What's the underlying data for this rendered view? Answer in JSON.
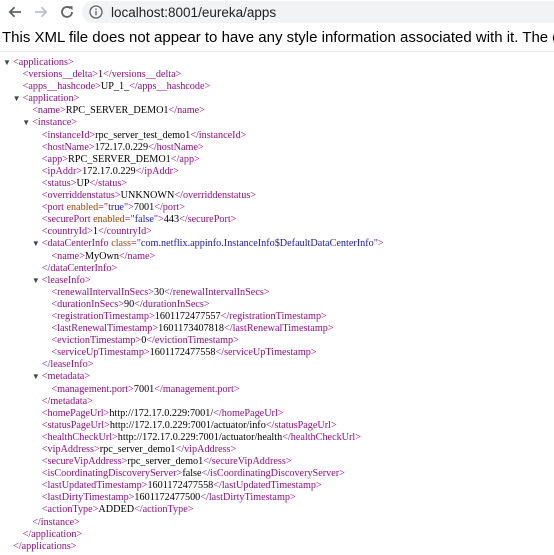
{
  "browser": {
    "url": "localhost:8001/eureka/apps",
    "back_icon": "back-arrow-icon",
    "forward_icon": "forward-arrow-icon",
    "reload_icon": "reload-icon",
    "info_icon": "info-circle-icon"
  },
  "page": {
    "notice": "This XML file does not appear to have any style information associated with it. The document tree is shown below."
  },
  "colors": {
    "tag": "#881280",
    "attr_name": "#994500",
    "attr_value": "#1a1aa6",
    "text": "#000000"
  },
  "xml_lines": [
    {
      "d": 0,
      "tog": "▼",
      "parts": [
        [
          "t",
          "<applications>"
        ]
      ]
    },
    {
      "d": 1,
      "parts": [
        [
          "t",
          "<versions__delta>"
        ],
        [
          "x",
          "1"
        ],
        [
          "t",
          "</versions__delta>"
        ]
      ]
    },
    {
      "d": 1,
      "parts": [
        [
          "t",
          "<apps__hashcode>"
        ],
        [
          "x",
          "UP_1_"
        ],
        [
          "t",
          "</apps__hashcode>"
        ]
      ]
    },
    {
      "d": 1,
      "tog": "▼",
      "parts": [
        [
          "t",
          "<application>"
        ]
      ]
    },
    {
      "d": 2,
      "parts": [
        [
          "t",
          "<name>"
        ],
        [
          "x",
          "RPC_SERVER_DEMO1"
        ],
        [
          "t",
          "</name>"
        ]
      ]
    },
    {
      "d": 2,
      "tog": "▼",
      "parts": [
        [
          "t",
          "<instance>"
        ]
      ]
    },
    {
      "d": 3,
      "parts": [
        [
          "t",
          "<instanceId>"
        ],
        [
          "x",
          "rpc_server_test_demo1"
        ],
        [
          "t",
          "</instanceId>"
        ]
      ]
    },
    {
      "d": 3,
      "parts": [
        [
          "t",
          "<hostName>"
        ],
        [
          "x",
          "172.17.0.229"
        ],
        [
          "t",
          "</hostName>"
        ]
      ]
    },
    {
      "d": 3,
      "parts": [
        [
          "t",
          "<app>"
        ],
        [
          "x",
          "RPC_SERVER_DEMO1"
        ],
        [
          "t",
          "</app>"
        ]
      ]
    },
    {
      "d": 3,
      "parts": [
        [
          "t",
          "<ipAddr>"
        ],
        [
          "x",
          "172.17.0.229"
        ],
        [
          "t",
          "</ipAddr>"
        ]
      ]
    },
    {
      "d": 3,
      "parts": [
        [
          "t",
          "<status>"
        ],
        [
          "x",
          "UP"
        ],
        [
          "t",
          "</status>"
        ]
      ]
    },
    {
      "d": 3,
      "parts": [
        [
          "t",
          "<overriddenstatus>"
        ],
        [
          "x",
          "UNKNOWN"
        ],
        [
          "t",
          "</overriddenstatus>"
        ]
      ]
    },
    {
      "d": 3,
      "parts": [
        [
          "t",
          "<port "
        ],
        [
          "a",
          "enabled"
        ],
        [
          "t",
          "=\""
        ],
        [
          "v",
          "true"
        ],
        [
          "t",
          "\">"
        ],
        [
          "x",
          "7001"
        ],
        [
          "t",
          "</port>"
        ]
      ]
    },
    {
      "d": 3,
      "parts": [
        [
          "t",
          "<securePort "
        ],
        [
          "a",
          "enabled"
        ],
        [
          "t",
          "=\""
        ],
        [
          "v",
          "false"
        ],
        [
          "t",
          "\">"
        ],
        [
          "x",
          "443"
        ],
        [
          "t",
          "</securePort>"
        ]
      ]
    },
    {
      "d": 3,
      "parts": [
        [
          "t",
          "<countryId>"
        ],
        [
          "x",
          "1"
        ],
        [
          "t",
          "</countryId>"
        ]
      ]
    },
    {
      "d": 3,
      "tog": "▼",
      "parts": [
        [
          "t",
          "<dataCenterInfo "
        ],
        [
          "a",
          "class"
        ],
        [
          "t",
          "=\""
        ],
        [
          "v",
          "com.netflix.appinfo.InstanceInfo$DefaultDataCenterInfo"
        ],
        [
          "t",
          "\">"
        ]
      ]
    },
    {
      "d": 4,
      "parts": [
        [
          "t",
          "<name>"
        ],
        [
          "x",
          "MyOwn"
        ],
        [
          "t",
          "</name>"
        ]
      ]
    },
    {
      "d": 3,
      "parts": [
        [
          "t",
          "</dataCenterInfo>"
        ]
      ]
    },
    {
      "d": 3,
      "tog": "▼",
      "parts": [
        [
          "t",
          "<leaseInfo>"
        ]
      ]
    },
    {
      "d": 4,
      "parts": [
        [
          "t",
          "<renewalIntervalInSecs>"
        ],
        [
          "x",
          "30"
        ],
        [
          "t",
          "</renewalIntervalInSecs>"
        ]
      ]
    },
    {
      "d": 4,
      "parts": [
        [
          "t",
          "<durationInSecs>"
        ],
        [
          "x",
          "90"
        ],
        [
          "t",
          "</durationInSecs>"
        ]
      ]
    },
    {
      "d": 4,
      "parts": [
        [
          "t",
          "<registrationTimestamp>"
        ],
        [
          "x",
          "1601172477557"
        ],
        [
          "t",
          "</registrationTimestamp>"
        ]
      ]
    },
    {
      "d": 4,
      "parts": [
        [
          "t",
          "<lastRenewalTimestamp>"
        ],
        [
          "x",
          "1601173407818"
        ],
        [
          "t",
          "</lastRenewalTimestamp>"
        ]
      ]
    },
    {
      "d": 4,
      "parts": [
        [
          "t",
          "<evictionTimestamp>"
        ],
        [
          "x",
          "0"
        ],
        [
          "t",
          "</evictionTimestamp>"
        ]
      ]
    },
    {
      "d": 4,
      "parts": [
        [
          "t",
          "<serviceUpTimestamp>"
        ],
        [
          "x",
          "1601172477558"
        ],
        [
          "t",
          "</serviceUpTimestamp>"
        ]
      ]
    },
    {
      "d": 3,
      "parts": [
        [
          "t",
          "</leaseInfo>"
        ]
      ]
    },
    {
      "d": 3,
      "tog": "▼",
      "parts": [
        [
          "t",
          "<metadata>"
        ]
      ]
    },
    {
      "d": 4,
      "parts": [
        [
          "t",
          "<management.port>"
        ],
        [
          "x",
          "7001"
        ],
        [
          "t",
          "</management.port>"
        ]
      ]
    },
    {
      "d": 3,
      "parts": [
        [
          "t",
          "</metadata>"
        ]
      ]
    },
    {
      "d": 3,
      "parts": [
        [
          "t",
          "<homePageUrl>"
        ],
        [
          "x",
          "http://172.17.0.229:7001/"
        ],
        [
          "t",
          "</homePageUrl>"
        ]
      ]
    },
    {
      "d": 3,
      "parts": [
        [
          "t",
          "<statusPageUrl>"
        ],
        [
          "x",
          "http://172.17.0.229:7001/actuator/info"
        ],
        [
          "t",
          "</statusPageUrl>"
        ]
      ]
    },
    {
      "d": 3,
      "parts": [
        [
          "t",
          "<healthCheckUrl>"
        ],
        [
          "x",
          "http://172.17.0.229:7001/actuator/health"
        ],
        [
          "t",
          "</healthCheckUrl>"
        ]
      ]
    },
    {
      "d": 3,
      "parts": [
        [
          "t",
          "<vipAddress>"
        ],
        [
          "x",
          "rpc_server_demo1"
        ],
        [
          "t",
          "</vipAddress>"
        ]
      ]
    },
    {
      "d": 3,
      "parts": [
        [
          "t",
          "<secureVipAddress>"
        ],
        [
          "x",
          "rpc_server_demo1"
        ],
        [
          "t",
          "</secureVipAddress>"
        ]
      ]
    },
    {
      "d": 3,
      "parts": [
        [
          "t",
          "<isCoordinatingDiscoveryServer>"
        ],
        [
          "x",
          "false"
        ],
        [
          "t",
          "</isCoordinatingDiscoveryServer>"
        ]
      ]
    },
    {
      "d": 3,
      "parts": [
        [
          "t",
          "<lastUpdatedTimestamp>"
        ],
        [
          "x",
          "1601172477558"
        ],
        [
          "t",
          "</lastUpdatedTimestamp>"
        ]
      ]
    },
    {
      "d": 3,
      "parts": [
        [
          "t",
          "<lastDirtyTimestamp>"
        ],
        [
          "x",
          "1601172477500"
        ],
        [
          "t",
          "</lastDirtyTimestamp>"
        ]
      ]
    },
    {
      "d": 3,
      "parts": [
        [
          "t",
          "<actionType>"
        ],
        [
          "x",
          "ADDED"
        ],
        [
          "t",
          "</actionType>"
        ]
      ]
    },
    {
      "d": 2,
      "parts": [
        [
          "t",
          "</instance>"
        ]
      ]
    },
    {
      "d": 1,
      "parts": [
        [
          "t",
          "</application>"
        ]
      ]
    },
    {
      "d": 0,
      "parts": [
        [
          "t",
          "</applications>"
        ]
      ]
    }
  ]
}
